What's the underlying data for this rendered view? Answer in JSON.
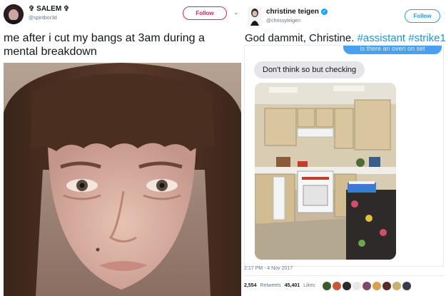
{
  "left_tweet": {
    "display_name": "✞ SALEM ✞",
    "handle": "@spiritbor3d",
    "follow_label": "Follow",
    "text": "me after i cut my bangs at 3am during a mental breakdown",
    "menu_icon": "chevron-down-icon",
    "photo": "close-up photo of a person with short dark brown bangs"
  },
  "right_tweet": {
    "display_name": "christine teigen",
    "verified": true,
    "handle": "@chrissyteigen",
    "follow_label": "Follow",
    "text_plain": "God dammit, Christine. ",
    "hashtag_1": "#assistant",
    "hashtag_2": "#strike1",
    "chat": {
      "outgoing_fragment": "is there an oven on set",
      "incoming": "Don't think so but checking",
      "photo": "photo of a small kitchen with beige cabinets and a white stove"
    },
    "timestamp": "2:17 PM - 4 Nov 2017",
    "retweets_count": "2,554",
    "retweets_label": "Retweets",
    "likes_count": "45,401",
    "likes_label": "Likes"
  },
  "colors": {
    "follow_pink": "#e0245e",
    "follow_blue": "#1da1f2",
    "hashtag": "#1b95e0",
    "muted": "#657786",
    "imessage_blue": "#4aa0f0",
    "imessage_gray": "#e5e5ea"
  }
}
